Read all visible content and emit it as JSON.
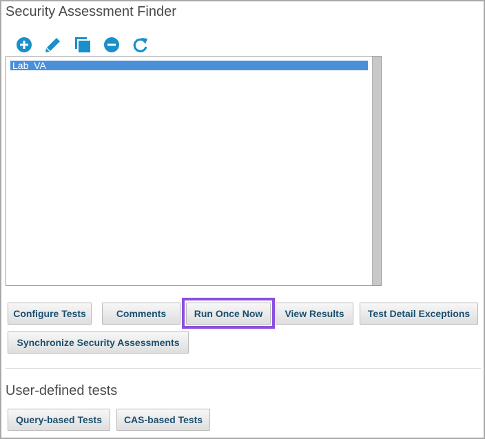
{
  "window": {
    "title": "Security Assessment Finder"
  },
  "toolbar": {
    "icons": [
      "add-icon",
      "edit-icon",
      "copy-icon",
      "remove-icon",
      "refresh-icon"
    ],
    "accent_color": "#1a8fc9"
  },
  "list": {
    "items": [
      {
        "label": "Lab_VA",
        "selected": true
      }
    ],
    "selection_color": "#4a90d9"
  },
  "buttons": {
    "configure_tests": "Configure Tests",
    "comments": "Comments",
    "run_once_now": "Run Once Now",
    "view_results": "View Results",
    "test_detail_exceptions": "Test Detail Exceptions",
    "synchronize": "Synchronize Security Assessments"
  },
  "highlight_color": "#8b4fe0",
  "user_defined": {
    "title": "User-defined tests",
    "query_based": "Query-based Tests",
    "cas_based": "CAS-based Tests"
  }
}
